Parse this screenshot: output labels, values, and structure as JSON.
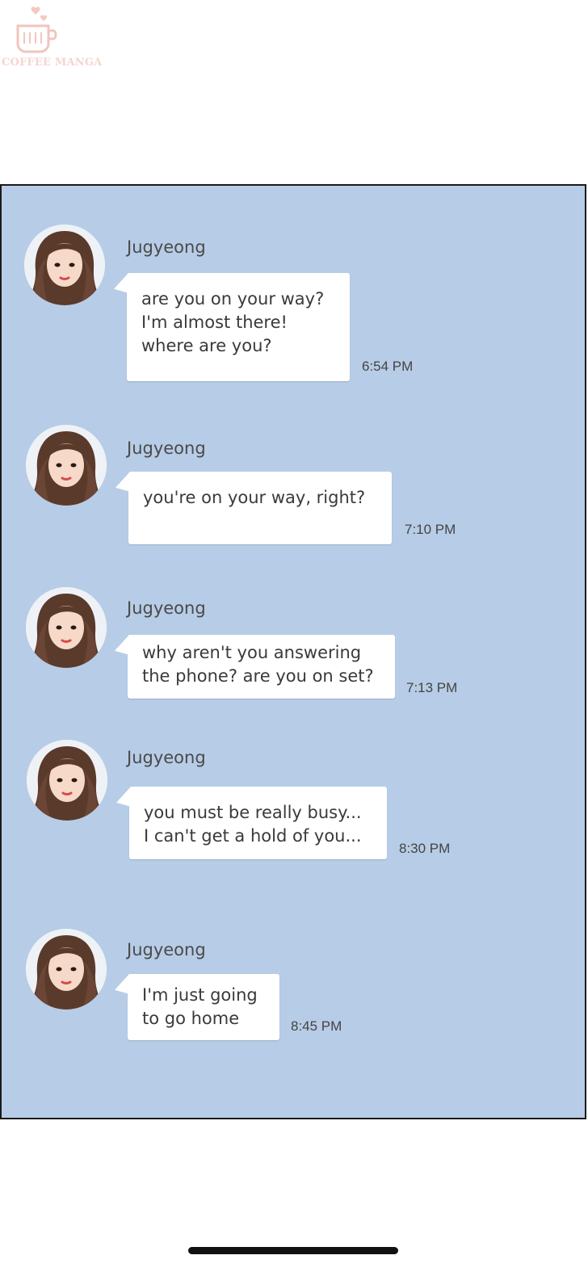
{
  "watermark": {
    "text": "COFFEE MANGA",
    "icon": "coffee-cup-logo-icon",
    "color": "#f2d6cf"
  },
  "chat": {
    "background": "#b7cce6",
    "messages": [
      {
        "sender": "Jugyeong",
        "lines": [
          "are you on your way?",
          "I'm almost there!",
          "where are you?"
        ],
        "time": "6:54 PM"
      },
      {
        "sender": "Jugyeong",
        "lines": [
          "you're on your way, right?"
        ],
        "time": "7:10 PM"
      },
      {
        "sender": "Jugyeong",
        "lines": [
          "why aren't you answering",
          "the phone? are you on set?"
        ],
        "time": "7:13 PM"
      },
      {
        "sender": "Jugyeong",
        "lines": [
          "you must be really busy...",
          "I can't get a hold of you..."
        ],
        "time": "8:30 PM"
      },
      {
        "sender": "Jugyeong",
        "lines": [
          "I'm just going",
          "to go home"
        ],
        "time": "8:45 PM"
      }
    ]
  },
  "home_indicator": {
    "icon": "home-indicator-bar"
  }
}
